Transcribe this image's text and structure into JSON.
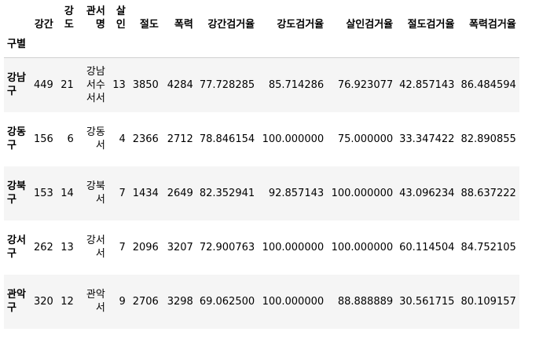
{
  "table": {
    "columns": [
      "강간",
      "강도",
      "관서명",
      "살인",
      "절도",
      "폭력",
      "강간검거율",
      "강도검거율",
      "살인검거율",
      "절도검거율",
      "폭력검거율"
    ],
    "index_name": "구별",
    "rows": [
      {
        "index": "강남구",
        "cells": [
          "449",
          "21",
          "강남서수서서",
          "13",
          "3850",
          "4284",
          "77.728285",
          "85.714286",
          "76.923077",
          "42.857143",
          "86.484594"
        ]
      },
      {
        "index": "강동구",
        "cells": [
          "156",
          "6",
          "강동서",
          "4",
          "2366",
          "2712",
          "78.846154",
          "100.000000",
          "75.000000",
          "33.347422",
          "82.890855"
        ]
      },
      {
        "index": "강북구",
        "cells": [
          "153",
          "14",
          "강북서",
          "7",
          "1434",
          "2649",
          "82.352941",
          "92.857143",
          "100.000000",
          "43.096234",
          "88.637222"
        ]
      },
      {
        "index": "강서구",
        "cells": [
          "262",
          "13",
          "강서서",
          "7",
          "2096",
          "3207",
          "72.900763",
          "100.000000",
          "100.000000",
          "60.114504",
          "84.752105"
        ]
      },
      {
        "index": "관악구",
        "cells": [
          "320",
          "12",
          "관악서",
          "9",
          "2706",
          "3298",
          "69.062500",
          "100.000000",
          "88.888889",
          "30.561715",
          "80.109157"
        ]
      }
    ]
  }
}
